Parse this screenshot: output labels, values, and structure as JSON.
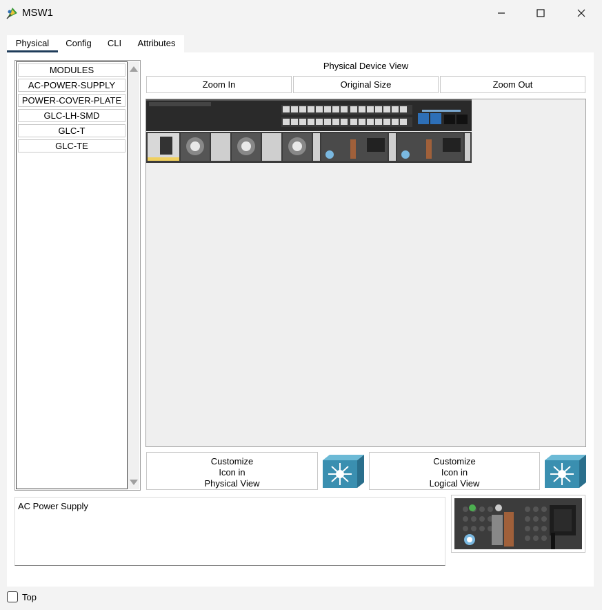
{
  "window": {
    "title": "MSW1",
    "controls": [
      "minimize-icon",
      "maximize-icon",
      "close-icon"
    ]
  },
  "tabs": [
    {
      "label": "Physical",
      "active": true
    },
    {
      "label": "Config",
      "active": false
    },
    {
      "label": "CLI",
      "active": false
    },
    {
      "label": "Attributes",
      "active": false
    }
  ],
  "modules": [
    {
      "label": "MODULES"
    },
    {
      "label": "AC-POWER-SUPPLY"
    },
    {
      "label": "POWER-COVER-PLATE"
    },
    {
      "label": "GLC-LH-SMD"
    },
    {
      "label": "GLC-T"
    },
    {
      "label": "GLC-TE"
    }
  ],
  "device_view": {
    "title": "Physical Device View",
    "zoom_in": "Zoom In",
    "original_size": "Original Size",
    "zoom_out": "Zoom Out"
  },
  "customize": {
    "physical": [
      "Customize",
      "Icon in",
      "Physical View"
    ],
    "logical": [
      "Customize",
      "Icon in",
      "Logical View"
    ],
    "icon": "multilayer-switch-icon"
  },
  "description": "AC Power Supply",
  "footer": {
    "top_label": "Top",
    "top_checked": false
  },
  "colors": {
    "tab_underline": "#1f3c5a",
    "switch_icon": "#3a8fb0"
  }
}
